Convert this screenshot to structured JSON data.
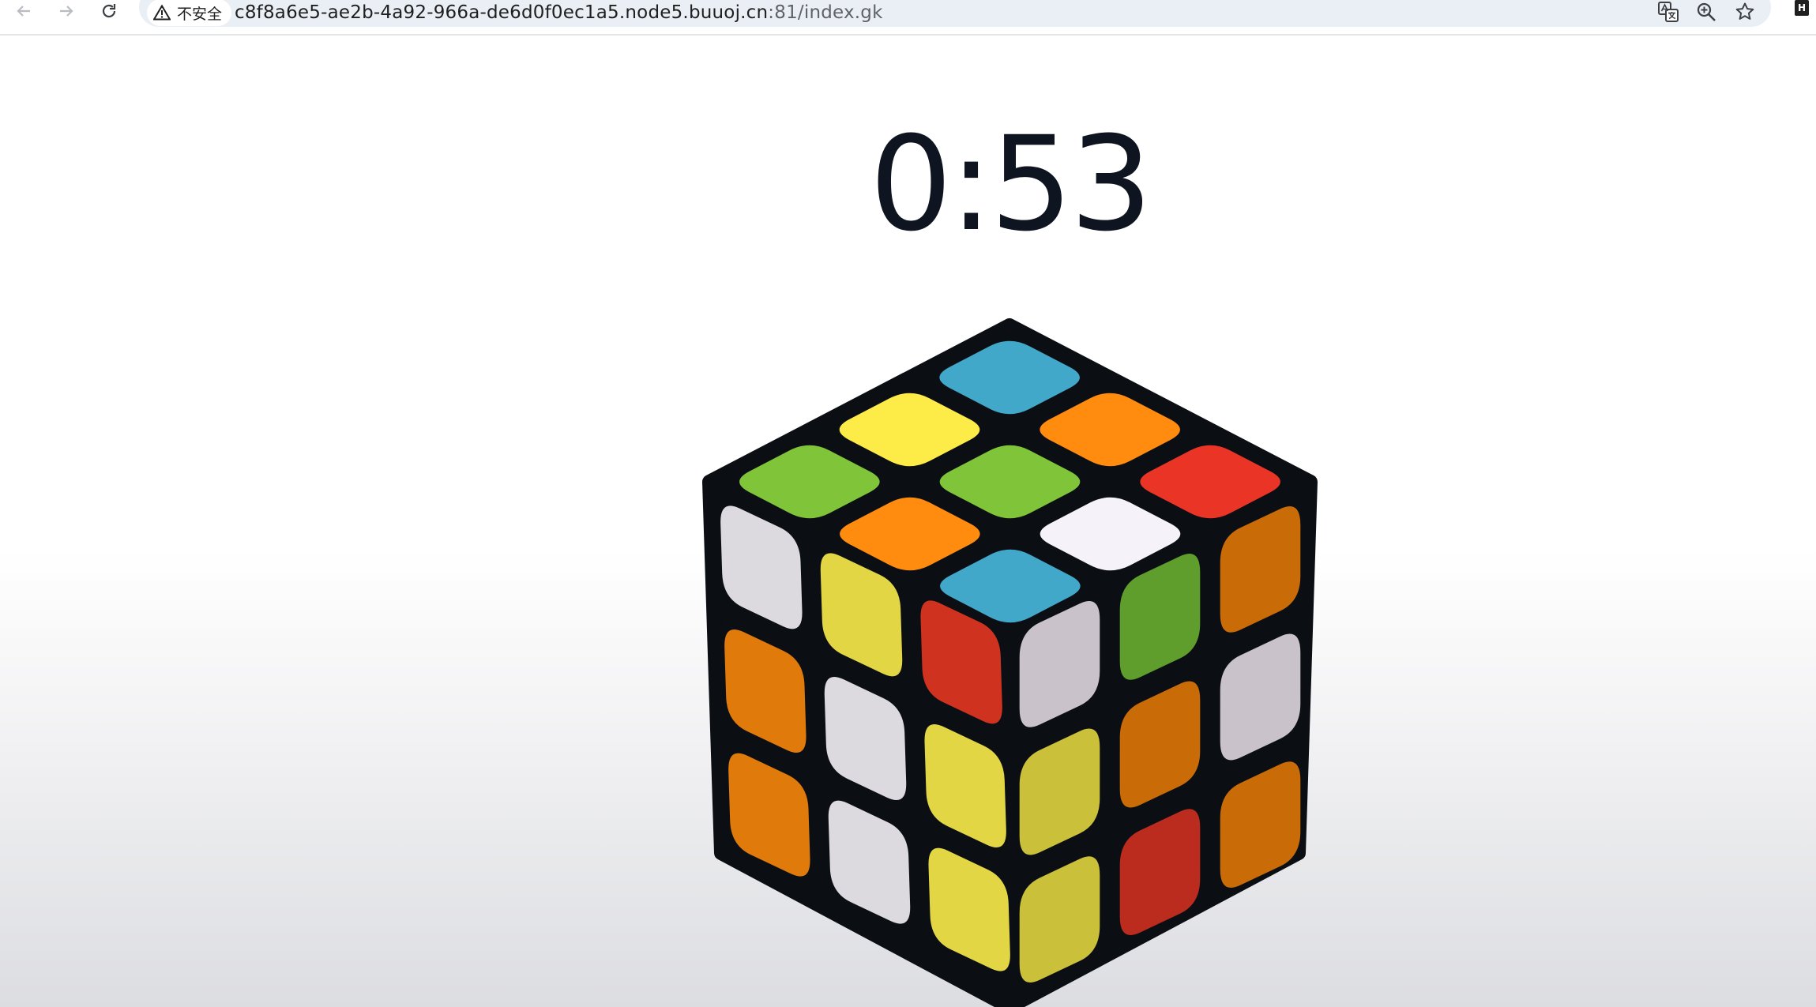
{
  "browser": {
    "security_label": "不安全",
    "url_host": "c8f8a6e5-ae2b-4a92-966a-de6d0f0ec1a5.node5.buuoj.cn",
    "url_path": ":81/index.gk",
    "profile_initial": "H"
  },
  "game": {
    "timer": "0:53",
    "cube": {
      "top": [
        [
          "#42a8c9",
          "#ff8c0f",
          "#ea3426"
        ],
        [
          "#fdeb47",
          "#80c539",
          "#f6f2fa"
        ],
        [
          "#80c539",
          "#ff8c0f",
          "#42a8c9"
        ]
      ],
      "left": [
        [
          "#dcd9df",
          "#df7a0b",
          "#df7a0b"
        ],
        [
          "#e2d645",
          "#dcd9df",
          "#dcd9df"
        ],
        [
          "#cf3320",
          "#e2d645",
          "#e2d645"
        ]
      ],
      "right": [
        [
          "#c9c2ca",
          "#cac03a",
          "#cac03a"
        ],
        [
          "#5f9e2d",
          "#c96c08",
          "#bb2c1e"
        ],
        [
          "#c96c08",
          "#c9c2ca",
          "#c96c08"
        ]
      ]
    }
  }
}
